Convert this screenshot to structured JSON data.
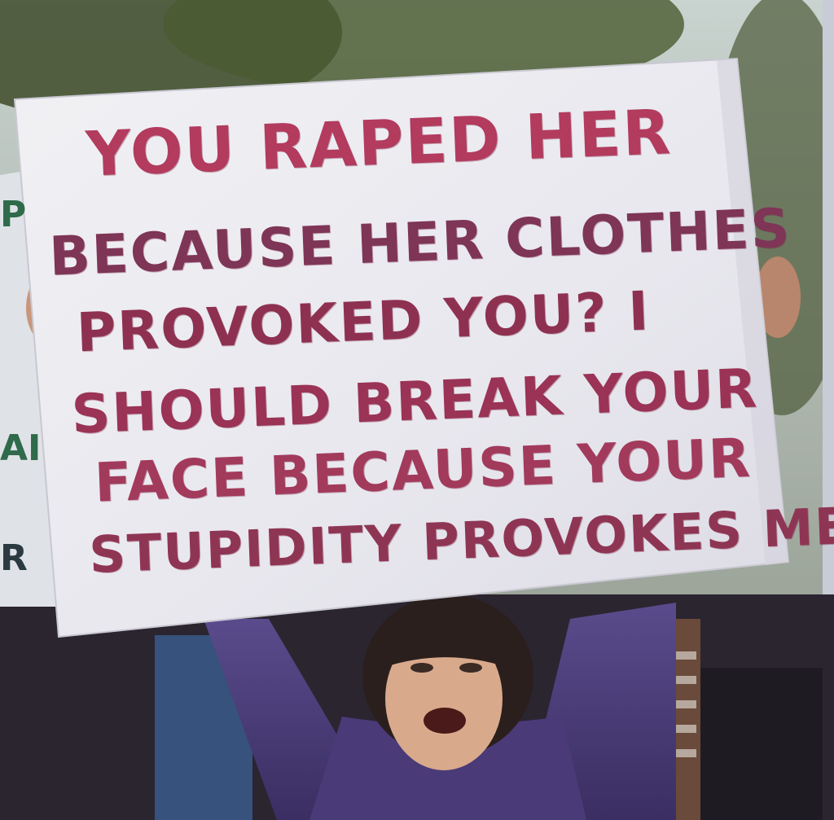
{
  "sign": {
    "lines": [
      "YOU RAPED HER",
      "BECAUSE HER CLOTHES",
      "PROVOKED YOU? I",
      "SHOULD BREAK YOUR",
      "FACE BECAUSE YOUR",
      "STUPIDITY PROVOKES ME."
    ]
  },
  "background_sign": {
    "fragments": [
      "P",
      "AI",
      "R"
    ]
  },
  "colors": {
    "sign_paper": "#ecebf0",
    "marker_red": "#a23a5c",
    "sweater": "#4a3a78",
    "foliage": "#3a4a2a"
  }
}
